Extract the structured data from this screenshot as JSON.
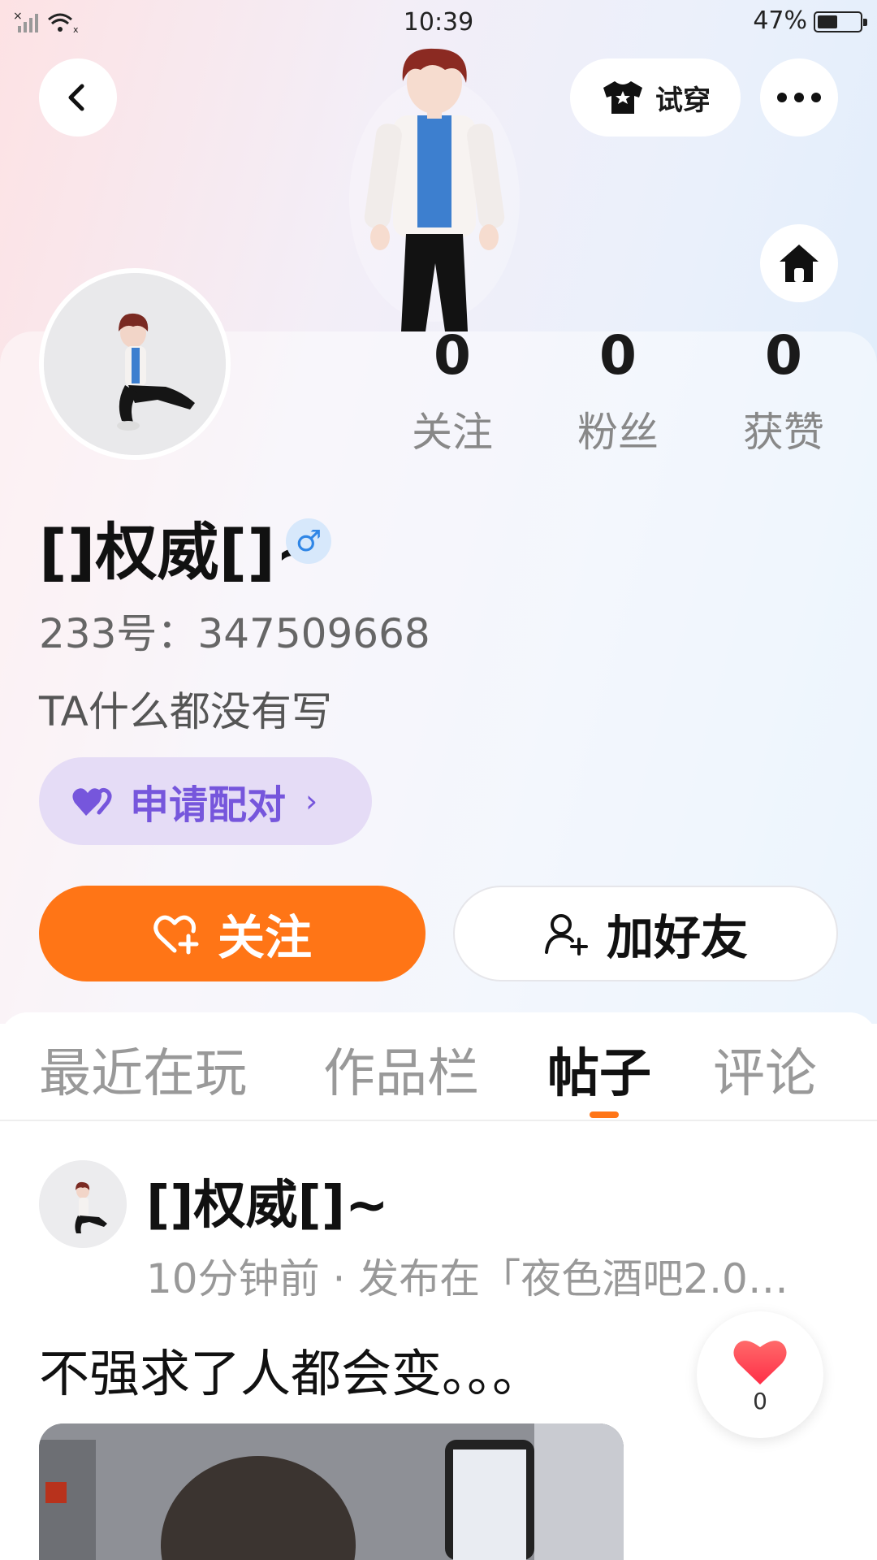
{
  "status_bar": {
    "time": "10:39",
    "battery": "47%"
  },
  "header": {
    "back_icon": "chevron-left-icon",
    "try_on_label": "试穿",
    "try_on_icon": "tshirt-icon",
    "more_icon": "more-horizontal-icon",
    "home_icon": "home-icon"
  },
  "stats": [
    {
      "value": "0",
      "label": "关注"
    },
    {
      "value": "0",
      "label": "粉丝"
    },
    {
      "value": "0",
      "label": "获赞"
    }
  ],
  "profile": {
    "username": "[]权威[]~",
    "gender_symbol": "♂",
    "uid": "233号：347509668",
    "bio": "TA什么都没有写",
    "pair_label": "申请配对",
    "pair_chevron": "›"
  },
  "actions": {
    "follow_label": "关注",
    "add_friend_label": "加好友"
  },
  "tabs": [
    {
      "label": "最近在玩",
      "active": false
    },
    {
      "label": "作品栏",
      "active": false
    },
    {
      "label": "帖子",
      "active": true
    },
    {
      "label": "评论",
      "active": false
    }
  ],
  "post": {
    "author": "[]权威[]~",
    "meta": "10分钟前 · 发布在「夜色酒吧2.0…",
    "text": "不强求了人都会变。。。",
    "likes": "0"
  },
  "colors": {
    "accent_orange": "#ff7516",
    "pair_purple": "#7656dc",
    "gender_blue": "#2f86e6"
  }
}
